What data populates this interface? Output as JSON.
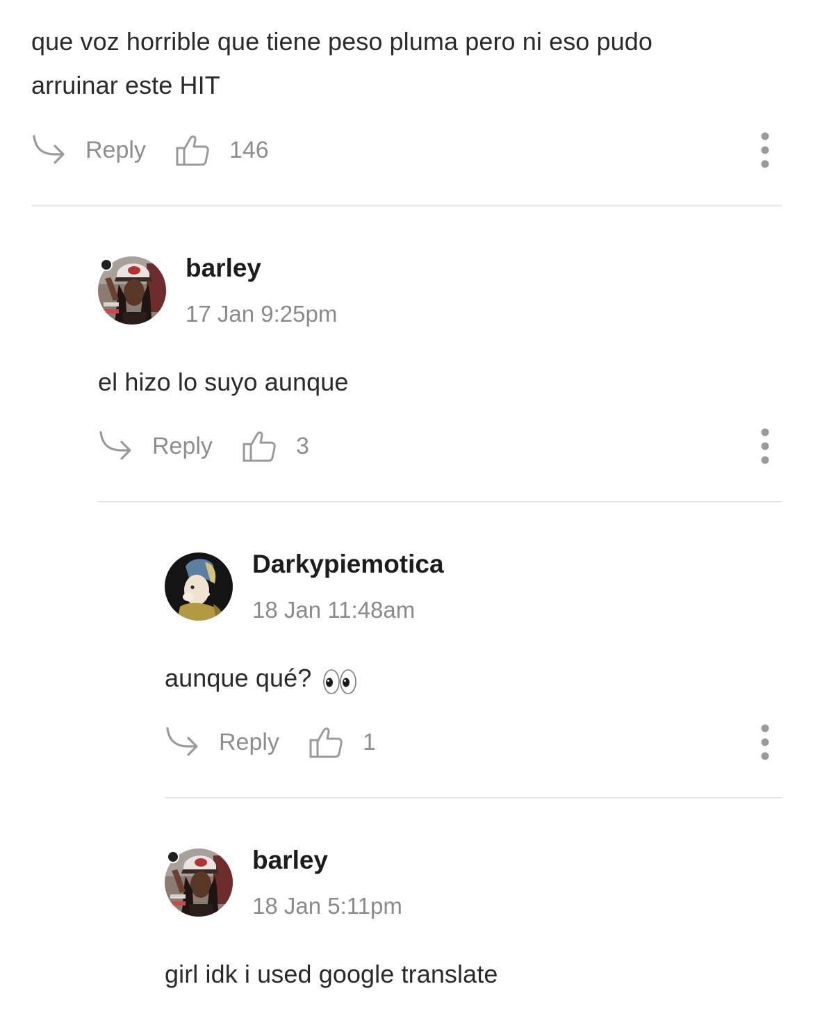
{
  "colors": {
    "text": "#2a2a2a",
    "muted": "#8d8d8d",
    "divider": "#e6e6e6"
  },
  "icons": {
    "reply": "reply-arrow-icon",
    "like": "thumbs-up-icon",
    "more": "vertical-ellipsis-icon",
    "eyes": "eyes-emoji"
  },
  "top_comment": {
    "text_line1": "que voz horrible que tiene peso pluma pero ni eso pudo",
    "text_line2": "arruinar este HIT",
    "reply_label": "Reply",
    "likes": "146"
  },
  "replies": [
    {
      "username": "barley",
      "timestamp": "17 Jan 9:25pm",
      "text": "el hizo lo suyo aunque",
      "reply_label": "Reply",
      "likes": "3"
    },
    {
      "username": "Darkypiemotica",
      "timestamp": "18 Jan 11:48am",
      "text": "aunque qué?",
      "reply_label": "Reply",
      "likes": "1"
    },
    {
      "username": "barley",
      "timestamp": "18 Jan 5:11pm",
      "text": "girl idk i used google translate"
    }
  ]
}
